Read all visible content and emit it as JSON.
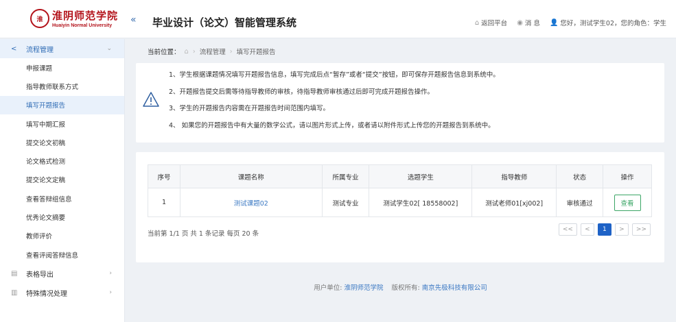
{
  "header": {
    "logo_cn": "淮阴师范学院",
    "logo_en": "Huaiyin Normal University",
    "collapse_icon": "double-chevron-left-icon",
    "title": "毕业设计（论文）智能管理系统",
    "return_label": "返回平台",
    "message_label": "消 息",
    "user_label": "您好，测试学生02，您的角色：学生"
  },
  "sidebar": {
    "group_main": {
      "label": "流程管理",
      "icon": "share-icon"
    },
    "items": [
      {
        "label": "申报课题"
      },
      {
        "label": "指导教师联系方式"
      },
      {
        "label": "填写开题报告"
      },
      {
        "label": "填写中期汇报"
      },
      {
        "label": "提交论文初稿"
      },
      {
        "label": "论文格式检测"
      },
      {
        "label": "提交论文定稿"
      },
      {
        "label": "查看答辩组信息"
      },
      {
        "label": "优秀论文摘要"
      },
      {
        "label": "教师评价"
      },
      {
        "label": "查看评阅答辩信息"
      }
    ],
    "group_export": {
      "label": "表格导出",
      "icon": "table-icon"
    },
    "group_special": {
      "label": "特殊情况处理",
      "icon": "document-icon"
    }
  },
  "breadcrumb": {
    "label": "当前位置：",
    "level1": "流程管理",
    "level2": "填写开题报告"
  },
  "notice": {
    "icon": "warning-icon",
    "lines": [
      "1、学生根据课题情况填写开题报告信息，填写完成后点“暂存”或者“提交”按钮，即可保存开题报告信息到系统中。",
      "2、开题报告提交后需等待指导教师的审核，待指导教师审核通过后即可完成开题报告操作。",
      "3、学生的开题报告内容需在开题报告时间范围内填写。",
      "4、 如果您的开题报告中有大量的数学公式，请以图片形式上传，或者请以附件形式上传您的开题报告到系统中。"
    ]
  },
  "table": {
    "headers": [
      "序号",
      "课题名称",
      "所属专业",
      "选题学生",
      "指导教师",
      "状态",
      "操作"
    ],
    "rows": [
      {
        "no": "1",
        "topic": "测试课题02",
        "major": "测试专业",
        "student": "测试学生02[ 18558002]",
        "teacher": "测试老师01[xj002]",
        "status": "审核通过",
        "action": "查看"
      }
    ]
  },
  "pagination": {
    "info": "当前第 1/1 页 共 1 条记录 每页 20 条",
    "first": "<<",
    "prev": "<",
    "current": "1",
    "next": ">",
    "last": ">>"
  },
  "footer": {
    "unit_label": "用户单位:",
    "unit": "淮阴师范学院",
    "copyright_label": "版权所有:",
    "company": "南京先极科技有限公司"
  },
  "colors": {
    "accent": "#1e62c6",
    "link": "#3a78c3",
    "brand": "#b3121a",
    "success": "#3aa565"
  }
}
